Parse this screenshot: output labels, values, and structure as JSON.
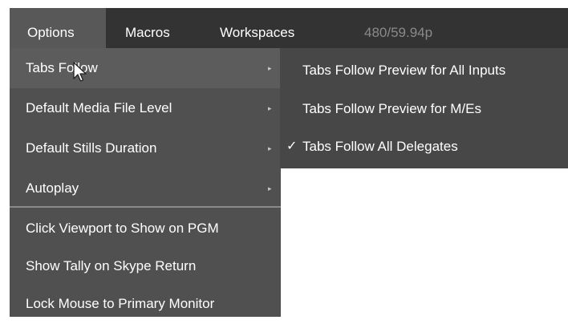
{
  "menubar": {
    "items": [
      {
        "label": "Options"
      },
      {
        "label": "Macros"
      },
      {
        "label": "Workspaces"
      }
    ],
    "status": "480/59.94p"
  },
  "dropdown": {
    "items": [
      {
        "label": "Tabs Follow",
        "has_submenu": true
      },
      {
        "label": "Default Media File Level",
        "has_submenu": true
      },
      {
        "label": "Default Stills Duration",
        "has_submenu": true
      },
      {
        "label": "Autoplay",
        "has_submenu": true
      },
      {
        "label": "Click Viewport to Show on PGM",
        "has_submenu": false
      },
      {
        "label": "Show Tally on Skype Return",
        "has_submenu": false
      },
      {
        "label": "Lock Mouse to Primary Monitor",
        "has_submenu": false
      }
    ],
    "arrow_glyph": "▸"
  },
  "submenu": {
    "items": [
      {
        "label": "Tabs Follow Preview for All Inputs",
        "check": ""
      },
      {
        "label": "Tabs Follow Preview for M/Es",
        "check": ""
      },
      {
        "label": "Tabs Follow All Delegates",
        "check": "✓"
      }
    ]
  },
  "icons": {
    "cursor": "mouse-pointer-icon",
    "submenu_arrow": "chevron-right-icon",
    "checkmark": "checkmark-icon"
  },
  "colors": {
    "menubar_bg": "#333333",
    "menubar_active": "#585858",
    "dropdown_bg": "#505050",
    "submenu_bg": "#474747",
    "status_text": "#8a8a8a"
  }
}
